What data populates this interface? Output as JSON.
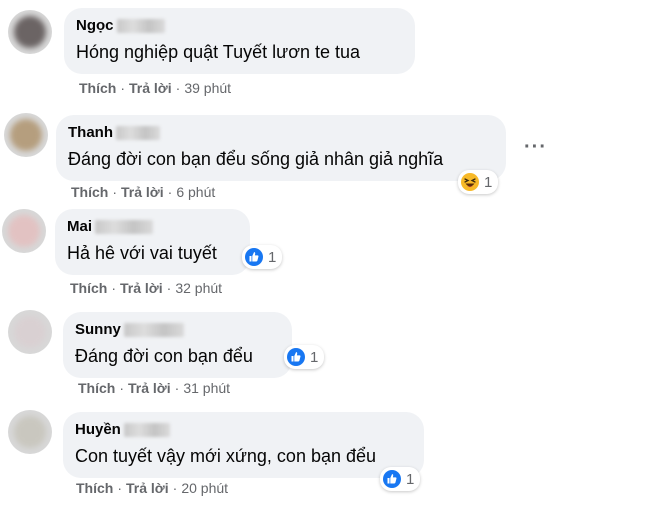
{
  "comments": [
    {
      "author": "Ngọc",
      "text": "Hóng nghiệp quật Tuyết lươn te tua",
      "like": "Thích",
      "reply": "Trả lời",
      "time": "39 phút",
      "avatar_color": "#6b6464"
    },
    {
      "author": "Thanh",
      "text": "Đáng đời con bạn đểu sống giả nhân giả nghĩa",
      "like": "Thích",
      "reply": "Trả lời",
      "time": "6 phút",
      "reaction_icon": "haha-icon",
      "reaction_count": "1",
      "avatar_color": "#b59e7e"
    },
    {
      "author": "Mai",
      "text": "Hả hê với vai tuyết",
      "like": "Thích",
      "reply": "Trả lời",
      "time": "32 phút",
      "reaction_icon": "like-icon",
      "reaction_count": "1",
      "avatar_color": "#e2c2c2"
    },
    {
      "author": "Sunny",
      "text": "Đáng đời con bạn đểu",
      "like": "Thích",
      "reply": "Trả lời",
      "time": "31 phút",
      "reaction_icon": "like-icon",
      "reaction_count": "1",
      "avatar_color": "#d9d0d2"
    },
    {
      "author": "Huyền",
      "text": "Con tuyết vậy mới xứng, con bạn đểu",
      "like": "Thích",
      "reply": "Trả lời",
      "time": "20 phút",
      "reaction_icon": "like-icon",
      "reaction_count": "1",
      "avatar_color": "#c9c7bf"
    }
  ],
  "more_options_icon": "more-options-icon",
  "colors": {
    "bubble": "#f0f2f5",
    "text": "#050505",
    "secondary": "#65676b",
    "like_blue": "#1877f2",
    "haha_yellow": "#f7b928"
  }
}
